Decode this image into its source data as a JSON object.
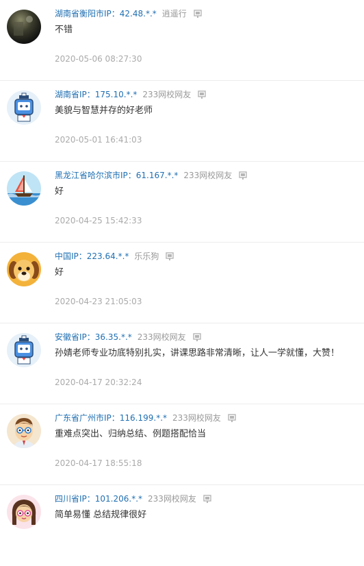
{
  "comments": [
    {
      "location": "湖南省衡阳市IP：42.48.*.*",
      "nickname": "逍遥行",
      "avatar": "dark-photo-avatar",
      "text": "不错",
      "time": "2020-05-06 08:27:30"
    },
    {
      "location": "湖南省IP：175.10.*.*",
      "nickname": "233网校网友",
      "avatar": "robot-sailor-avatar",
      "text": "美貌与智慧并存的好老师",
      "time": "2020-05-01 16:41:03"
    },
    {
      "location": "黑龙江省哈尔滨市IP：61.167.*.*",
      "nickname": "233网校网友",
      "avatar": "sailboat-avatar",
      "text": "好",
      "time": "2020-04-25 15:42:33"
    },
    {
      "location": "中国IP：223.64.*.*",
      "nickname": "乐乐狗",
      "avatar": "dog-avatar",
      "text": "好",
      "time": "2020-04-23 21:05:03"
    },
    {
      "location": "安徽省IP：36.35.*.*",
      "nickname": "233网校网友",
      "avatar": "robot-sailor-avatar",
      "text": "孙婧老师专业功底特别扎实，讲课思路非常清晰，让人一学就懂，大赞！",
      "time": "2020-04-17 20:32:24"
    },
    {
      "location": "广东省广州市IP：116.199.*.*",
      "nickname": "233网校网友",
      "avatar": "glasses-boy-avatar",
      "text": "重难点突出、归纳总结、例题搭配恰当",
      "time": "2020-04-17 18:55:18"
    },
    {
      "location": "四川省IP：101.206.*.*",
      "nickname": "233网校网友",
      "avatar": "glasses-girl-avatar",
      "text": "简单易懂 总结规律很好",
      "time": ""
    }
  ],
  "colors": {
    "location_link": "#1f6fb2",
    "nickname": "#999999",
    "text": "#333333",
    "time": "#aaaaaa",
    "divider": "#ececec"
  },
  "icons": {
    "report": "report-icon"
  }
}
